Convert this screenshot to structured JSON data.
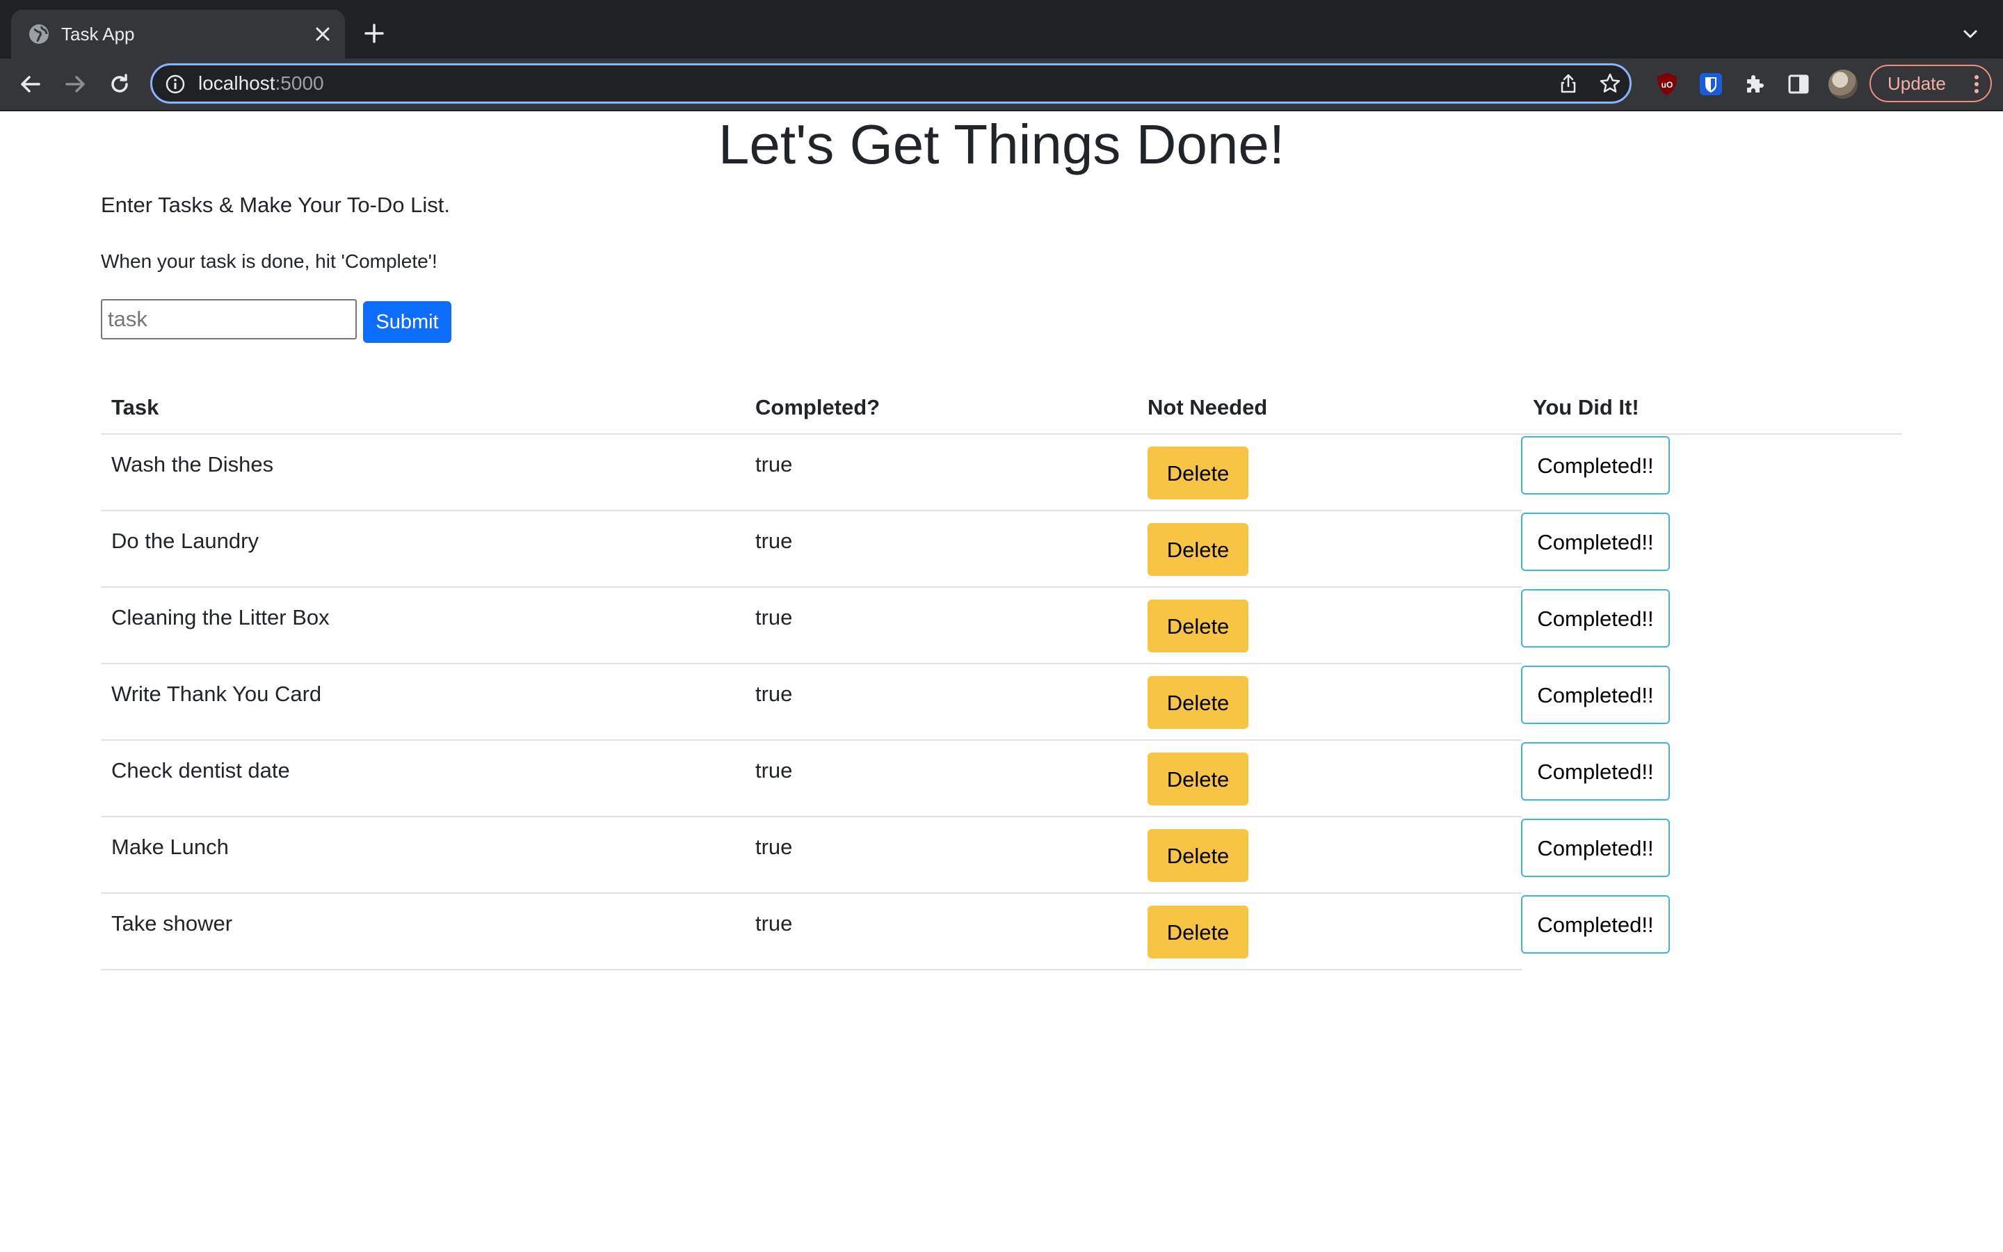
{
  "browser": {
    "tab_title": "Task App",
    "url_host": "localhost",
    "url_port": ":5000",
    "update_label": "Update"
  },
  "page": {
    "title": "Let's Get Things Done!",
    "intro": "Enter Tasks & Make Your To-Do List.",
    "hint": "When your task is done, hit 'Complete'!",
    "input_placeholder": "task",
    "input_value": "",
    "submit_label": "Submit"
  },
  "table": {
    "headers": [
      "Task",
      "Completed?",
      "Not Needed",
      "You Did It!"
    ],
    "rows": [
      {
        "task": "Wash the Dishes",
        "completed": "true",
        "delete_label": "Delete",
        "complete_label": "Completed!!"
      },
      {
        "task": "Do the Laundry",
        "completed": "true",
        "delete_label": "Delete",
        "complete_label": "Completed!!"
      },
      {
        "task": "Cleaning the Litter Box",
        "completed": "true",
        "delete_label": "Delete",
        "complete_label": "Completed!!"
      },
      {
        "task": "Write Thank You Card",
        "completed": "true",
        "delete_label": "Delete",
        "complete_label": "Completed!!"
      },
      {
        "task": "Check dentist date",
        "completed": "true",
        "delete_label": "Delete",
        "complete_label": "Completed!!"
      },
      {
        "task": "Make Lunch",
        "completed": "true",
        "delete_label": "Delete",
        "complete_label": "Completed!!"
      },
      {
        "task": "Take shower",
        "completed": "true",
        "delete_label": "Delete",
        "complete_label": "Completed!!"
      }
    ]
  },
  "colors": {
    "primary": "#0d6efd",
    "warning": "#f7c444",
    "info_outline": "#3fb5dc"
  }
}
